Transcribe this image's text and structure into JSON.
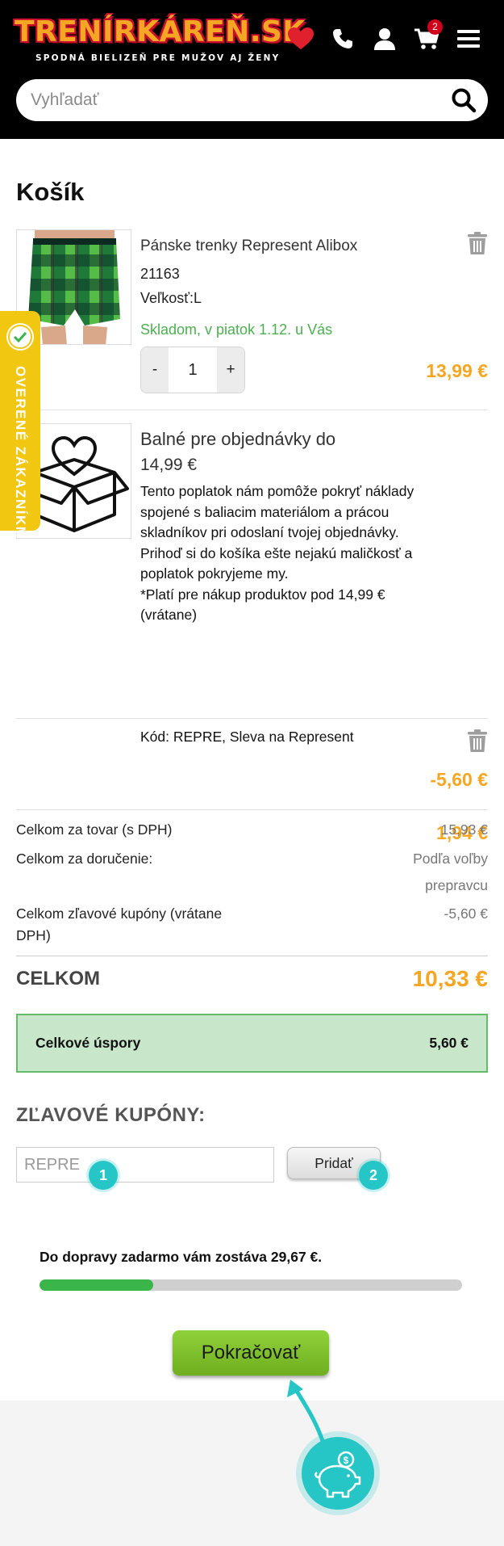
{
  "header": {
    "logo_text": "TRENÍRKÁREŇ.SK",
    "logo_tagline": "SPODNÁ BIELIZEŇ PRE MUŽOV AJ ŽENY",
    "cart_count": "2",
    "search_placeholder": "Vyhľadať"
  },
  "side_tab": {
    "label": "OVERENÉ ZÁKAZNÍKMI"
  },
  "cart": {
    "title": "Košík",
    "items": [
      {
        "name": "Pánske trenky Represent Alibox",
        "code": "21163",
        "size": "Veľkosť:L",
        "stock": "Skladom, v piatok 1.12. u Vás",
        "qty_minus": "-",
        "qty": "1",
        "qty_plus": "+",
        "price": "13,99 €"
      },
      {
        "name": "Balné pre objednávky do",
        "subtitle": "14,99 €",
        "desc1": "Tento poplatok nám pomôže pokryť náklady spojené s baliacim materiálom a prácou skladníkov pri odoslaní tvojej objednávky. Prihoď si do košíka ešte nejakú maličkosť a poplatok pokryjeme my.",
        "desc2": "*Platí pre nákup produktov pod 14,99 € (vrátane)",
        "price": "1,94 €"
      },
      {
        "name": "Kód: REPRE, Sleva na Represent",
        "price": "-5,60 €"
      }
    ]
  },
  "summary": {
    "rows": [
      {
        "label": "Celkom za tovar (s DPH)",
        "value": "15,93 €"
      },
      {
        "label": "Celkom za doručenie:",
        "value": "Podľa voľby prepravcu"
      },
      {
        "label": "Celkom zľavové kupóny (vrátane DPH)",
        "value": "-5,60 €"
      }
    ],
    "total_label": "CELKOM",
    "total_value": "10,33 €",
    "savings_label": "Celkové úspory",
    "savings_value": "5,60 €"
  },
  "coupons": {
    "title": "ZĽAVOVÉ KUPÓNY:",
    "input_value": "REPRE",
    "add_label": "Pridať",
    "step1": "1",
    "step2": "2"
  },
  "shipping": {
    "text": "Do dopravy zadarmo vám zostáva 29,67 €.",
    "progress": 0.27
  },
  "continue_label": "Pokračovať",
  "colors": {
    "header_bg": "#000000",
    "accent_orange": "#f5a623",
    "stock_green": "#4caf50",
    "continue_green": "#7cbf29",
    "teal_marker": "#26c6c6",
    "side_tab_yellow": "#f2c712"
  },
  "icons": [
    "heart-icon",
    "phone-icon",
    "user-icon",
    "cart-icon",
    "menu-icon",
    "search-icon",
    "trash-icon",
    "piggy-bank-icon"
  ]
}
